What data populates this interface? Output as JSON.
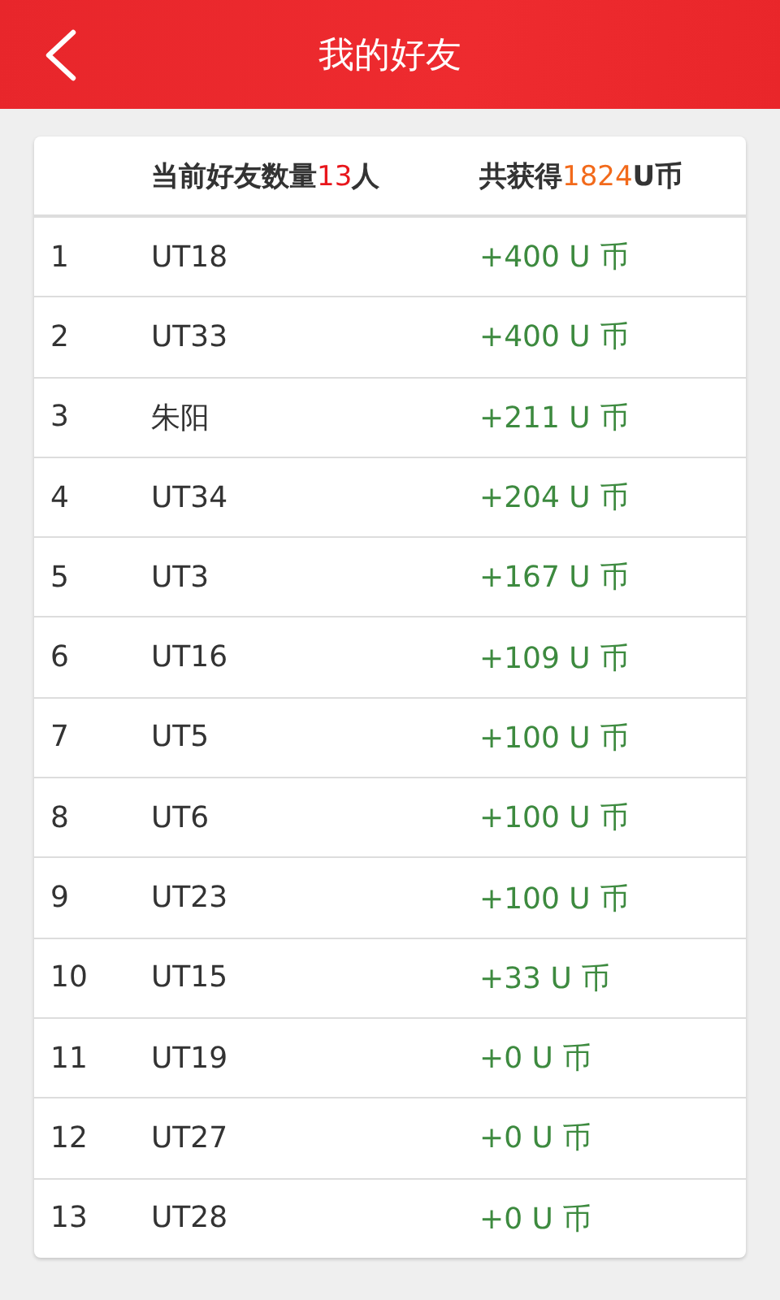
{
  "header": {
    "title": "我的好友"
  },
  "summary": {
    "friends": {
      "prefix": "当前好友数量",
      "value": "13",
      "suffix": "人"
    },
    "earned": {
      "prefix": "共获得",
      "value": "1824",
      "suffix": "U币"
    }
  },
  "rows": [
    {
      "index": "1",
      "name": "UT18",
      "reward": "+400 U 币"
    },
    {
      "index": "2",
      "name": "UT33",
      "reward": "+400 U 币"
    },
    {
      "index": "3",
      "name": "朱阳",
      "reward": "+211 U 币"
    },
    {
      "index": "4",
      "name": "UT34",
      "reward": "+204 U 币"
    },
    {
      "index": "5",
      "name": "UT3",
      "reward": "+167 U 币"
    },
    {
      "index": "6",
      "name": "UT16",
      "reward": "+109 U 币"
    },
    {
      "index": "7",
      "name": "UT5",
      "reward": "+100 U 币"
    },
    {
      "index": "8",
      "name": "UT6",
      "reward": "+100 U 币"
    },
    {
      "index": "9",
      "name": "UT23",
      "reward": "+100 U 币"
    },
    {
      "index": "10",
      "name": "UT15",
      "reward": "+33 U 币"
    },
    {
      "index": "11",
      "name": "UT19",
      "reward": "+0 U 币"
    },
    {
      "index": "12",
      "name": "UT27",
      "reward": "+0 U 币"
    },
    {
      "index": "13",
      "name": "UT28",
      "reward": "+0 U 币"
    }
  ]
}
